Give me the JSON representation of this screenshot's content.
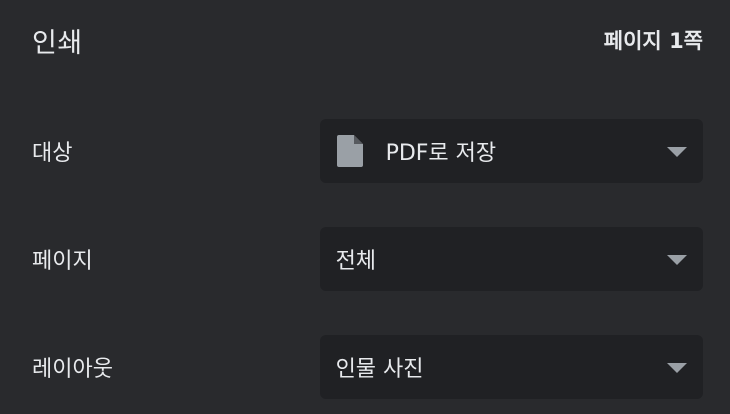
{
  "header": {
    "title": "인쇄",
    "page_count": "페이지 1쪽"
  },
  "rows": [
    {
      "label": "대상",
      "value": "PDF로 저장",
      "icon": "document-icon"
    },
    {
      "label": "페이지",
      "value": "전체"
    },
    {
      "label": "레이아웃",
      "value": "인물 사진"
    }
  ],
  "colors": {
    "background": "#292a2d",
    "field_background": "#202124",
    "text": "#e8eaed",
    "icon": "#9aa0a6"
  }
}
